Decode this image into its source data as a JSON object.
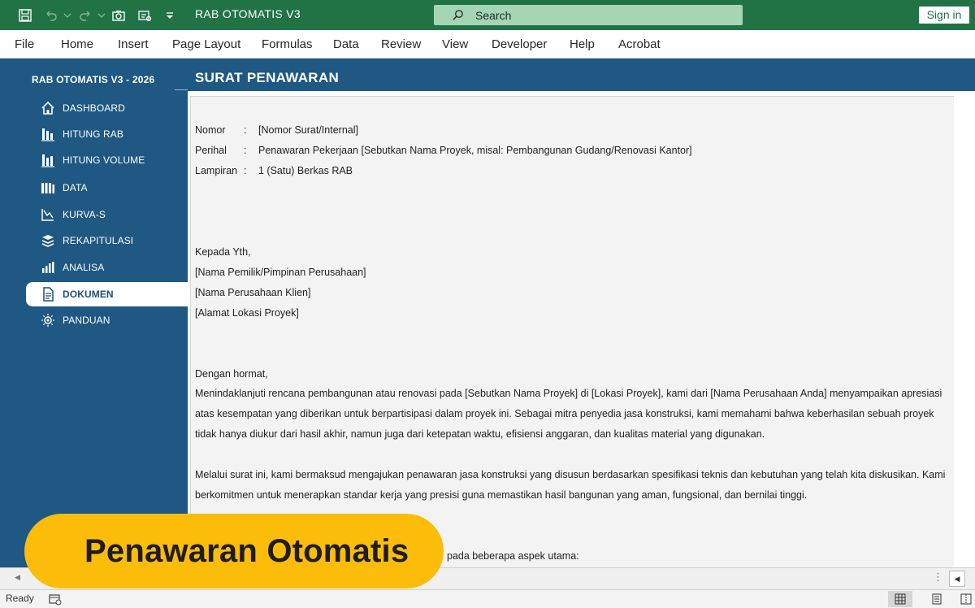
{
  "window": {
    "title": "RAB OTOMATIS V3",
    "signin_label": "Sign in"
  },
  "search": {
    "placeholder": "Search"
  },
  "ribbon": {
    "tabs": [
      "File",
      "Home",
      "Insert",
      "Page Layout",
      "Formulas",
      "Data",
      "Review",
      "View",
      "Developer",
      "Help",
      "Acrobat"
    ]
  },
  "sidebar": {
    "title": "RAB OTOMATIS V3 - 2026",
    "items": [
      {
        "label": "DASHBOARD",
        "icon": "home-icon"
      },
      {
        "label": "HITUNG RAB",
        "icon": "calculate-icon"
      },
      {
        "label": "HITUNG VOLUME",
        "icon": "volume-icon"
      },
      {
        "label": "DATA",
        "icon": "data-icon"
      },
      {
        "label": "KURVA-S",
        "icon": "curve-icon"
      },
      {
        "label": "REKAPITULASI",
        "icon": "stack-icon"
      },
      {
        "label": "ANALISA",
        "icon": "bar-chart-icon"
      },
      {
        "label": "DOKUMEN",
        "icon": "document-icon",
        "active": true
      },
      {
        "label": "PANDUAN",
        "icon": "lightbulb-icon"
      }
    ]
  },
  "page": {
    "title": "SURAT PENAWARAN"
  },
  "document": {
    "nomor_label": "Nomor",
    "nomor_value": "[Nomor Surat/Internal]",
    "perihal_label": "Perihal",
    "perihal_value": "Penawaran Pekerjaan [Sebutkan Nama Proyek, misal: Pembangunan Gudang/Renovasi Kantor]",
    "lampiran_label": "Lampiran",
    "lampiran_value": "1 (Satu) Berkas RAB",
    "colon": ":",
    "recipient": [
      "Kepada Yth,",
      "[Nama Pemilik/Pimpinan Perusahaan]",
      "[Nama Perusahaan Klien]",
      "[Alamat Lokasi Proyek]"
    ],
    "greeting": "Dengan hormat,",
    "para1": [
      "Menindaklanjuti rencana pembangunan atau renovasi pada [Sebutkan Nama Proyek] di [Lokasi Proyek], kami dari [Nama Perusahaan Anda] menyampaikan apresiasi",
      "atas kesempatan yang diberikan untuk berpartisipasi dalam proyek ini. Sebagai mitra penyedia jasa konstruksi, kami memahami bahwa keberhasilan sebuah proyek",
      "tidak hanya diukur dari hasil akhir, namun juga dari ketepatan waktu, efisiensi anggaran, dan kualitas material yang digunakan."
    ],
    "para2": [
      "Melalui surat ini, kami bermaksud mengajukan penawaran jasa konstruksi yang disusun berdasarkan spesifikasi teknis dan kebutuhan yang telah kita diskusikan. Kami",
      "berkomitmen untuk menerapkan standar kerja yang presisi guna memastikan hasil bangunan yang aman, fungsional, dan bernilai tinggi."
    ],
    "partial_line": "pada beberapa aspek utama:"
  },
  "banner": {
    "text": "Penawaran Otomatis"
  },
  "status": {
    "ready": "Ready"
  }
}
